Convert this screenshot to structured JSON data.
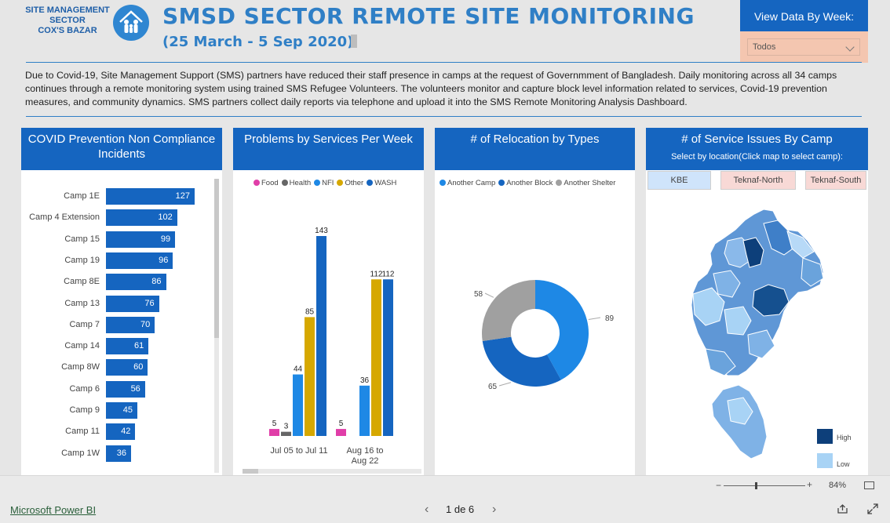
{
  "header": {
    "logo_text": [
      "SITE MANAGEMENT",
      "SECTOR",
      "COX'S BAZAR"
    ],
    "title": "SMSD SECTOR REMOTE SITE MONITORING",
    "subtitle": "(25 March - 5 Sep 2020)"
  },
  "week_filter": {
    "label": "View Data By Week:",
    "value": "Todos"
  },
  "intro": "Due to Covid-19, Site Management Support (SMS) partners have reduced their staff presence in camps at the request of Governmment of Bangladesh. Daily monitoring across all 34 camps continues through a remote monitoring system using trained SMS Refugee Volunteers. The volunteers monitor and capture block level information related to services, Covid-19 prevention measures, and community dynamics. SMS partners collect daily reports via telephone and upload it into the SMS Remote Monitoring Analysis Dashboard.",
  "cards": {
    "covid": [
      "COVID Prevention Non Compliance",
      "Incidents"
    ],
    "problems": "Problems by Services Per Week",
    "relocation": "# of Relocation by Types",
    "service": "# of Service Issues By Camp",
    "service_sub": "Select by location(Click map to select camp):"
  },
  "locations": [
    "KBE",
    "Teknaf-North",
    "Teknaf-South"
  ],
  "map_legend": {
    "high": "High",
    "low": "Low",
    "high_color": "#0d3f7a",
    "low_color": "#a8d3f5"
  },
  "chart_data": [
    {
      "type": "bar",
      "orientation": "horizontal",
      "categories": [
        "Camp 1E",
        "Camp 4 Extension",
        "Camp 15",
        "Camp 19",
        "Camp 8E",
        "Camp 13",
        "Camp 7",
        "Camp 14",
        "Camp 8W",
        "Camp 6",
        "Camp 9",
        "Camp 11",
        "Camp 1W"
      ],
      "values": [
        127,
        102,
        99,
        96,
        86,
        76,
        70,
        61,
        60,
        56,
        45,
        42,
        36
      ],
      "color": "#1565c0"
    },
    {
      "type": "bar",
      "categories": [
        "Jul 05 to Jul 11",
        "Aug 16 to Aug 22"
      ],
      "series": [
        {
          "name": "Food",
          "color": "#e03ea8",
          "values": [
            5,
            5
          ]
        },
        {
          "name": "Health",
          "color": "#666666",
          "values": [
            3,
            null
          ]
        },
        {
          "name": "NFI",
          "color": "#1e88e5",
          "values": [
            44,
            36
          ]
        },
        {
          "name": "Other",
          "color": "#d6a800",
          "values": [
            85,
            112
          ]
        },
        {
          "name": "WASH",
          "color": "#1565c0",
          "values": [
            143,
            112
          ]
        }
      ]
    },
    {
      "type": "pie",
      "donut": true,
      "slices": [
        {
          "name": "Another Camp",
          "value": 89,
          "color": "#1e88e5"
        },
        {
          "name": "Another Block",
          "value": 65,
          "color": "#1565c0"
        },
        {
          "name": "Another Shelter",
          "value": 58,
          "color": "#a0a0a0"
        }
      ]
    }
  ],
  "footer": {
    "zoom": "84%",
    "app_link": "Microsoft Power BI",
    "pager": "1 de 6"
  }
}
